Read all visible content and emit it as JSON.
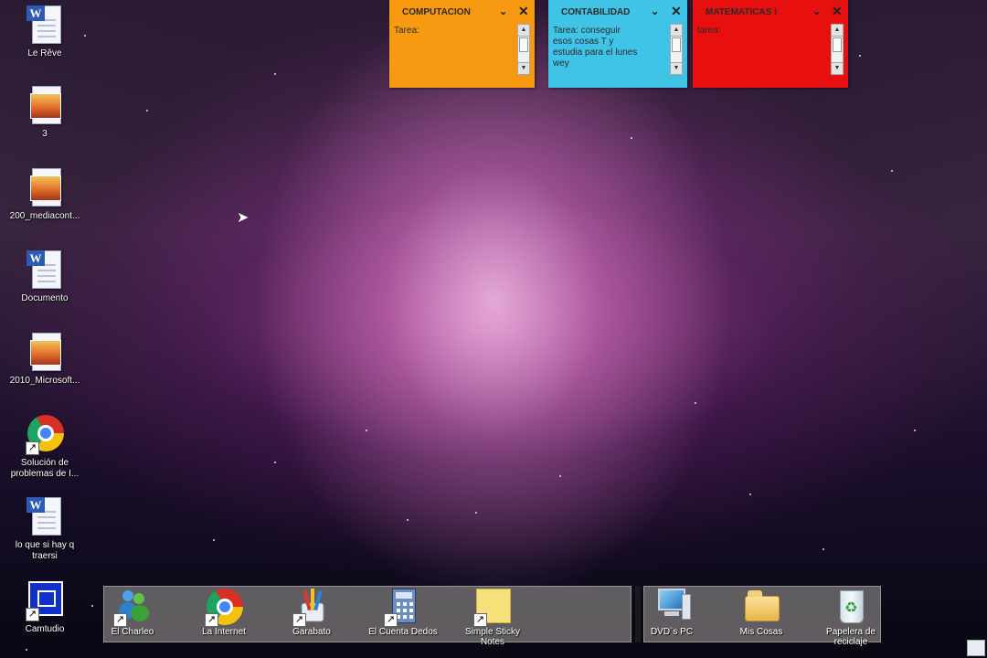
{
  "desktop_icons": [
    {
      "label": "Le Rêve",
      "icon": "word-document-icon"
    },
    {
      "label": "3",
      "icon": "image-file-icon"
    },
    {
      "label": "200_mediacont...",
      "icon": "image-file-icon"
    },
    {
      "label": "Documento",
      "icon": "word-document-icon"
    },
    {
      "label": "2010_Microsoft...",
      "icon": "image-file-icon"
    },
    {
      "label": "Solución de\nproblemas de I...",
      "icon": "chrome-shortcut-icon"
    },
    {
      "label": "lo que si hay q\ntraersi",
      "icon": "word-document-icon"
    },
    {
      "label": "Camtudio",
      "icon": "recorder-shortcut-icon"
    }
  ],
  "notes": [
    {
      "title": "COMPUTACION",
      "body": "Tarea:",
      "color": "#f79a12"
    },
    {
      "title": "CONTABILIDAD",
      "body": "Tarea: conseguir\nesos cosas T y\nestudia para el lunes\nwey",
      "color": "#3fc3e6"
    },
    {
      "title": "MATEMATICAS I",
      "body": "tarea:",
      "color": "#e8100f"
    }
  ],
  "dock_left": [
    {
      "label": "El Charleo",
      "icon": "messenger-icon"
    },
    {
      "label": "La Internet",
      "icon": "chrome-icon"
    },
    {
      "label": "Garabato",
      "icon": "paint-icon"
    },
    {
      "label": "El Cuenta Dedos",
      "icon": "calculator-icon"
    },
    {
      "label": "Simple Sticky\nNotes",
      "icon": "sticky-notes-icon"
    }
  ],
  "dock_right": [
    {
      "label": "DVD`s PC",
      "icon": "computer-icon"
    },
    {
      "label": "Mis Cosas",
      "icon": "folder-icon"
    },
    {
      "label": "Papelera de\nreciclaje",
      "icon": "recycle-bin-icon"
    }
  ],
  "colors": {
    "dock": "#787474",
    "computacion": "#f79a12",
    "contabilidad": "#3fc3e6",
    "matematicas": "#e8100f"
  }
}
